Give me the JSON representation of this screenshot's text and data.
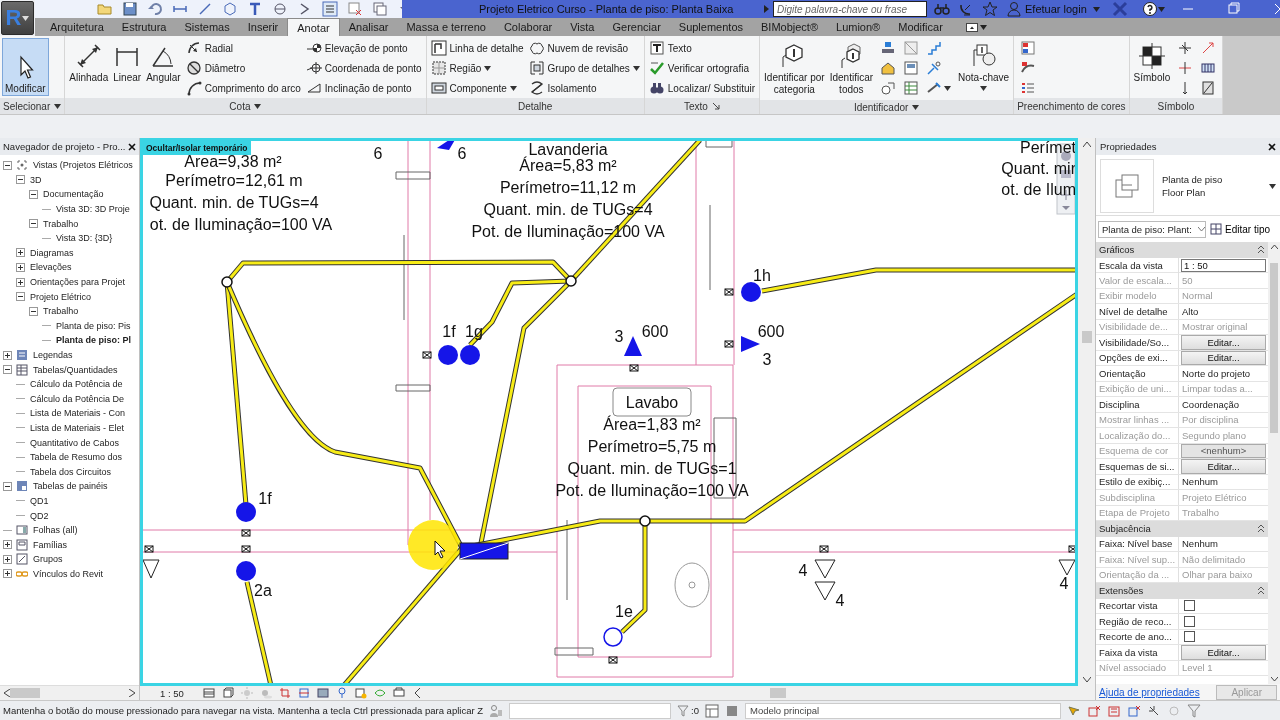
{
  "title_bar": {
    "app_button": "R",
    "title": "Projeto Eletrico Curso - Planta de piso: Planta Baixa",
    "search": {
      "placeholder": "Digite palavra-chave ou frase"
    },
    "login": "Efetuar login"
  },
  "tabs": [
    {
      "label": "Arquitetura",
      "selected": false
    },
    {
      "label": "Estrutura",
      "selected": false
    },
    {
      "label": "Sistemas",
      "selected": false
    },
    {
      "label": "Inserir",
      "selected": false
    },
    {
      "label": "Anotar",
      "selected": true
    },
    {
      "label": "Analisar",
      "selected": false
    },
    {
      "label": "Massa e terreno",
      "selected": false
    },
    {
      "label": "Colaborar",
      "selected": false
    },
    {
      "label": "Vista",
      "selected": false
    },
    {
      "label": "Gerenciar",
      "selected": false
    },
    {
      "label": "Suplementos",
      "selected": false
    },
    {
      "label": "BIMobject®",
      "selected": false
    },
    {
      "label": "Lumion®",
      "selected": false
    },
    {
      "label": "Modificar",
      "selected": false
    }
  ],
  "ribbon_panels": [
    {
      "label": "Selecionar",
      "menu": true,
      "tools": [
        {
          "kind": "large",
          "label": "Modificar",
          "active": true
        }
      ]
    },
    {
      "label": "Cota",
      "menu": true,
      "tools": [
        {
          "kind": "large",
          "label": "Alinhada"
        },
        {
          "kind": "large",
          "label": "Linear"
        },
        {
          "kind": "large",
          "label": "Angular"
        },
        {
          "kind": "small",
          "label": "Radial"
        },
        {
          "kind": "small",
          "label": "Diâmetro"
        },
        {
          "kind": "small",
          "label": "Comprimento do arco"
        },
        {
          "kind": "small",
          "label": "Elevação de ponto"
        },
        {
          "kind": "small",
          "label": "Coordenada de ponto"
        },
        {
          "kind": "small",
          "label": "Inclinação de ponto"
        }
      ]
    },
    {
      "label": "Detalhe",
      "tools": [
        {
          "kind": "small",
          "label": "Linha de detalhe"
        },
        {
          "kind": "small",
          "label": "Região",
          "dropdown": true
        },
        {
          "kind": "small",
          "label": "Componente",
          "dropdown": true
        },
        {
          "kind": "small",
          "label": "Nuvem de revisão"
        },
        {
          "kind": "small",
          "label": "Grupo de detalhes",
          "dropdown": true
        },
        {
          "kind": "small",
          "label": "Isolamento"
        }
      ]
    },
    {
      "label": "Texto",
      "launcher": true,
      "tools": [
        {
          "kind": "small",
          "label": "Texto"
        },
        {
          "kind": "small",
          "label": "Verificar ortografia"
        },
        {
          "kind": "small",
          "label": "Localizar/ Substituir"
        }
      ]
    },
    {
      "label": "Identificador",
      "menu": true,
      "tools": [
        {
          "kind": "large",
          "label": "Identificar por\ncategoria"
        },
        {
          "kind": "large",
          "label": "Identificar\ntodos"
        },
        {
          "kind": "icon_grid"
        },
        {
          "kind": "large",
          "label": "Nota-chave",
          "dropdown": true
        }
      ]
    },
    {
      "label": "Preenchimento de cores",
      "tools": [
        {
          "kind": "icon_grid"
        }
      ]
    },
    {
      "label": "Símbolo",
      "tools": [
        {
          "kind": "large",
          "label": "Símbolo"
        },
        {
          "kind": "icon_grid"
        }
      ]
    }
  ],
  "project_browser": {
    "title": "Navegador de projeto - Pro...",
    "tree": [
      {
        "label": "Vistas (Projetos Elétricos",
        "expanded": true,
        "selected": false,
        "children": [
          {
            "label": "3D",
            "expanded": true,
            "selected": false,
            "children": [
              {
                "label": "Documentação",
                "expanded": true,
                "selected": false,
                "children": [
                  {
                    "label": "Vista 3D: 3D Proje",
                    "selected": false
                  }
                ]
              },
              {
                "label": "Trabalho",
                "expanded": true,
                "selected": false,
                "children": [
                  {
                    "label": "Vista 3D: {3D}",
                    "selected": false
                  }
                ]
              }
            ]
          },
          {
            "label": "Diagramas",
            "expanded": false,
            "selected": false
          },
          {
            "label": "Elevações",
            "expanded": false,
            "selected": false
          },
          {
            "label": "Orientações para Projet",
            "expanded": false,
            "selected": false
          },
          {
            "label": "Projeto Elétrico",
            "expanded": true,
            "selected": false,
            "children": [
              {
                "label": "Trabalho",
                "expanded": true,
                "selected": false,
                "children": [
                  {
                    "label": "Planta de piso: Pis",
                    "selected": false
                  },
                  {
                    "label": "Planta de piso: Pl",
                    "selected": true
                  }
                ]
              }
            ]
          }
        ]
      },
      {
        "label": "Legendas",
        "expanded": false,
        "selected": false
      },
      {
        "label": "Tabelas/Quantidades",
        "expanded": true,
        "selected": false,
        "children": [
          {
            "label": "Cálculo da Potência de",
            "selected": false
          },
          {
            "label": "Cálculo da Potência De",
            "selected": false
          },
          {
            "label": "Lista de Materiais - Con",
            "selected": false
          },
          {
            "label": "Lista de Materiais - Elet",
            "selected": false
          },
          {
            "label": "Quantitativo de Cabos",
            "selected": false
          },
          {
            "label": "Tabela de Resumo dos",
            "selected": false
          },
          {
            "label": "Tabela dos Circuitos",
            "selected": false
          }
        ]
      },
      {
        "label": "Tabelas de painéis",
        "expanded": true,
        "selected": false,
        "children": [
          {
            "label": "QD1",
            "selected": false
          },
          {
            "label": "QD2",
            "selected": false
          }
        ]
      },
      {
        "label": "Folhas (all)",
        "selected": false
      },
      {
        "label": "Famílias",
        "expanded": false,
        "selected": false
      },
      {
        "label": "Grupos",
        "expanded": false,
        "selected": false
      },
      {
        "label": "Vínculos do Revit",
        "expanded": false,
        "selected": false
      }
    ]
  },
  "view": {
    "badge": "Ocultar/Isolar temporário",
    "rooms": [
      {
        "lines": [
          "Área=9,38 m²",
          "Perímetro=12,61 m",
          "Quant. min. de TUGs=4",
          "ot. de Iluminação=100 VA"
        ]
      },
      {
        "name": "Lavanderia",
        "lines": [
          "Área=5,83 m²",
          "Perímetro=11,12 m",
          "Quant. min. de TUGs=4",
          "Pot. de Iluminação=100 VA"
        ]
      },
      {
        "lines": [
          "Perímet",
          "Quant. mir",
          "ot. de Ilum"
        ]
      },
      {
        "name": "Lavabo",
        "lines": [
          "Área=1,83 m²",
          "Perímetro=5,75 m",
          "Quant. min. de TUGs=1",
          "Pot. de Iluminação=100 VA"
        ]
      }
    ],
    "tags": [
      "6",
      "6",
      "1h",
      "1f",
      "1g",
      "3",
      "600",
      "600",
      "3",
      "1f",
      "2a",
      "1e",
      "4",
      "4",
      "4"
    ],
    "scale": "1 : 50"
  },
  "properties": {
    "title": "Propriedades",
    "type_name": "Planta de piso",
    "type_subname": "Floor Plan",
    "instance": "Planta de piso: Plant:",
    "edit_type": "Editar tipo",
    "groups": [
      {
        "name": "Gráficos",
        "rows": [
          {
            "label": "Escala da vista",
            "value": "1 : 50",
            "kind": "field",
            "disabled": false
          },
          {
            "label": "Valor de escala...",
            "value": "50",
            "kind": "text",
            "disabled": true
          },
          {
            "label": "Exibir modelo",
            "value": "Normal",
            "kind": "text",
            "disabled": true
          },
          {
            "label": "Nível de detalhe",
            "value": "Alto",
            "kind": "text",
            "disabled": false
          },
          {
            "label": "Visibilidade de...",
            "value": "Mostrar original",
            "kind": "text",
            "disabled": true
          },
          {
            "label": "Visibilidade/So...",
            "value": "Editar...",
            "kind": "button",
            "disabled": false
          },
          {
            "label": "Opções de exi...",
            "value": "Editar...",
            "kind": "button",
            "disabled": false
          },
          {
            "label": "Orientação",
            "value": "Norte do projeto",
            "kind": "text",
            "disabled": false
          },
          {
            "label": "Exibição de uni...",
            "value": "Limpar todas a...",
            "kind": "text",
            "disabled": true
          },
          {
            "label": "Disciplina",
            "value": "Coordenação",
            "kind": "text",
            "disabled": false
          },
          {
            "label": "Mostrar linhas ...",
            "value": "Por disciplina",
            "kind": "text",
            "disabled": true
          },
          {
            "label": "Localização do...",
            "value": "Segundo plano",
            "kind": "text",
            "disabled": true
          },
          {
            "label": "Esquema de cor",
            "value": "<nenhum>",
            "kind": "button",
            "disabled": true
          },
          {
            "label": "Esquemas de si...",
            "value": "Editar...",
            "kind": "button",
            "disabled": false
          },
          {
            "label": "Estilo de exibiç...",
            "value": "Nenhum",
            "kind": "text",
            "disabled": false
          },
          {
            "label": "Subdisciplina",
            "value": "Projeto Elétrico",
            "kind": "text",
            "disabled": true
          },
          {
            "label": "Etapa de Projeto",
            "value": "Trabalho",
            "kind": "text",
            "disabled": true
          }
        ]
      },
      {
        "name": "Subjacência",
        "rows": [
          {
            "label": "Faixa: Nível base",
            "value": "Nenhum",
            "kind": "text",
            "disabled": false
          },
          {
            "label": "Faixa: Nível sup...",
            "value": "Não delimitado",
            "kind": "text",
            "disabled": true
          },
          {
            "label": "Orientação da ...",
            "value": "Olhar para baixo",
            "kind": "text",
            "disabled": true
          }
        ]
      },
      {
        "name": "Extensões",
        "rows": [
          {
            "label": "Recortar vista",
            "kind": "check",
            "checked": false,
            "disabled": false
          },
          {
            "label": "Região de reco...",
            "kind": "check",
            "checked": false,
            "disabled": false
          },
          {
            "label": "Recorte de ano...",
            "kind": "check",
            "checked": false,
            "disabled": false
          },
          {
            "label": "Faixa da vista",
            "value": "Editar...",
            "kind": "button",
            "disabled": false
          },
          {
            "label": "Nível associado",
            "value": "Level 1",
            "kind": "text",
            "disabled": true
          }
        ]
      }
    ],
    "help_link": "Ajuda de propriedades",
    "apply": "Aplicar"
  },
  "status_bar": {
    "message": "Mantenha o botão do mouse pressionado para navegar na vista. Mantenha a tecla Ctrl pressionada para aplicar Z",
    "filter_count": ":0",
    "workset": "Modelo principal"
  }
}
